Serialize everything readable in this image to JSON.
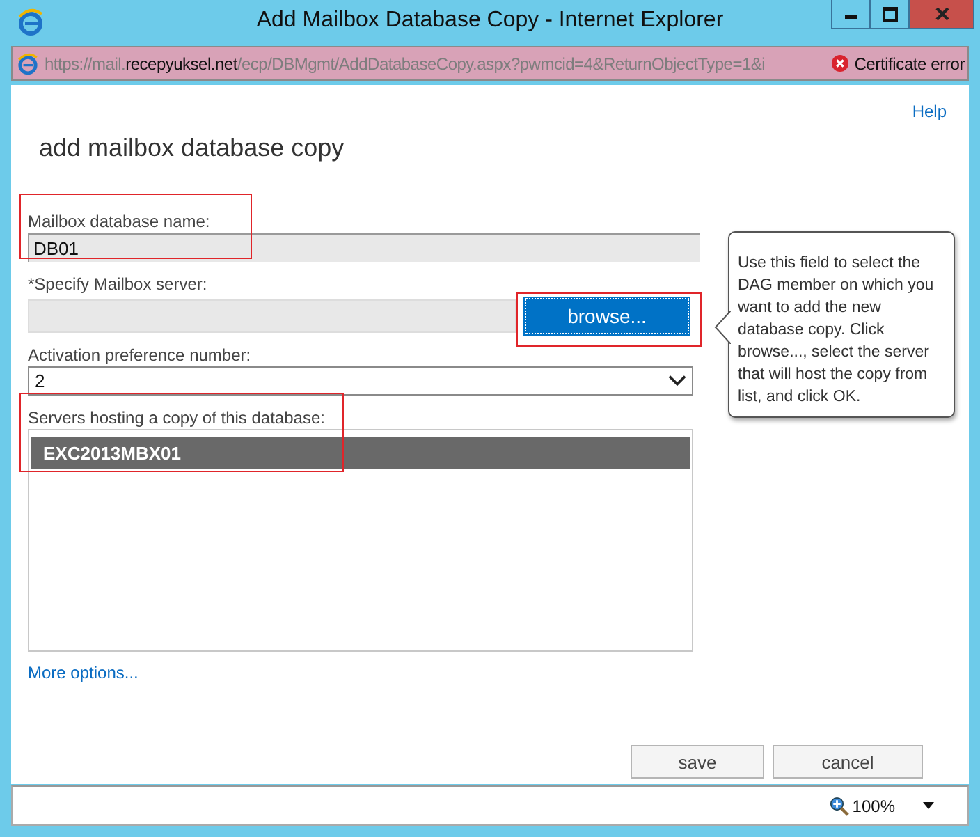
{
  "window": {
    "title": "Add Mailbox Database Copy - Internet Explorer",
    "controls": [
      {
        "kind": "minimize"
      },
      {
        "kind": "maximize"
      },
      {
        "kind": "close"
      }
    ]
  },
  "address_bar": {
    "url": "https://mail.**recepyuksel.net**/ecp/DBMgmt/AddDatabaseCopy.aspx?pwmcid=4&ReturnObjectType=1&i",
    "certificate_error": "Certificate error"
  },
  "help_link": "Help",
  "heading": "add mailbox database copy",
  "fields": [
    {
      "kind": "text",
      "label": "Mailbox database name:",
      "value": "DB01",
      "highlighted": true
    },
    {
      "kind": "browse",
      "label": "*Specify Mailbox server:",
      "button": "browse...",
      "highlighted": true
    },
    {
      "kind": "select",
      "label": "Activation preference number:",
      "value": "2",
      "highlighted": false
    },
    {
      "kind": "list",
      "label": "Servers hosting a copy of this database:",
      "items": [
        {
          "name": "EXC2013MBX01",
          "selected": true
        }
      ],
      "highlighted": true
    }
  ],
  "tooltip": "Use this field to select the DAG member on which you want to add the new database copy. Click browse..., select the server that will host the copy from list, and click OK.",
  "more_options": "More options...",
  "buttons": [
    "save",
    "cancel"
  ],
  "status_bar": {
    "zoom": "100%"
  }
}
